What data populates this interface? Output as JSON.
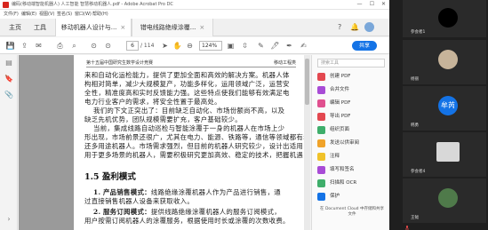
{
  "titlebar": {
    "title": "编码(移动端智能机器人) 人工智能 智慧移动机器人.pdf - Adobe Acrobat Pro DC",
    "minimize": "—",
    "maximize": "☐",
    "close": "✕"
  },
  "menubar": [
    "文件(F)",
    "编辑(E)",
    "视图(V)",
    "签名(S)",
    "窗口(W)",
    "帮助(H)"
  ],
  "tabs": {
    "home": "主页",
    "tools": "工具",
    "doc": "移动机器人设计与...",
    "doc2": "错电线路绝缘涂覆..."
  },
  "toolbar": {
    "page_current": "6",
    "page_total": "/ 114",
    "zoom": "124%",
    "share_label": "共享"
  },
  "document": {
    "header_left": "第十五届中国研究生数学设计竞赛",
    "header_right": "移动工程类",
    "lines": [
      "来和自动化运检能力，提供了更加全面和高效的解决方案。机器人体",
      "构相对简单，减少大规模复产，功能多样化，运用领域广泛，运营安",
      "全性，精准度高和实时反馈能力强。这些特点使我们能够有效满足电",
      "电力行业客户的需求，将安全性置于最高处。",
      "我们的下文正突出了：目前缺乏自动化、市场份额尚不高，以及",
      "缺乏先机优势，团队规模需要扩充，客户基础较少。",
      "当前，集成线路自动巡检与智能涂覆于一身的机器人在市场上少",
      "形出现，市场前景还很广，尤其在电力、能源、铁路等，通信等领域都有着",
      "还多用途机器人。市场需求强烈，但目前的机器人研究较少，设计出适用",
      "用于更多场景的机器人，需要积极研究更加高效、稳定的技术，把握机遇！"
    ],
    "heading": "1.5 盈利模式",
    "sections": [
      {
        "num": "1.",
        "title": "产品销售模式：",
        "text": "线路绝缘涂覆机器人作为产品进行销售，通"
      },
      {
        "num": "",
        "title": "",
        "text": "过直接销售机器人设备来获取收入。"
      },
      {
        "num": "2.",
        "title": "服务订阅模式：",
        "text": "提供线路绝缘涂覆机器人的服务订阅模式，"
      },
      {
        "num": "",
        "title": "",
        "text": "用户按需订阅机器人的涂覆服务，根据使用时长或涂覆的次数收费。"
      }
    ]
  },
  "tools_pane": {
    "search_placeholder": "搜索工具",
    "items": [
      {
        "label": "创建 PDF",
        "color": "#e34850"
      },
      {
        "label": "合并文件",
        "color": "#a84cd6"
      },
      {
        "label": "编辑 PDF",
        "color": "#e0508f"
      },
      {
        "label": "导出 PDF",
        "color": "#e34850"
      },
      {
        "label": "组织页面",
        "color": "#3fae6b"
      },
      {
        "label": "发送以供审阅",
        "color": "#f0a32a"
      },
      {
        "label": "注释",
        "color": "#f0c22a"
      },
      {
        "label": "填写和签名",
        "color": "#a84cd6"
      },
      {
        "label": "扫描和 OCR",
        "color": "#3fae6b"
      },
      {
        "label": "保护",
        "color": "#1473e6"
      }
    ],
    "promo": "在 Document Cloud 中存储和共享文件"
  },
  "call_panel": {
    "participants": [
      {
        "name": "参会者1",
        "avatar": "",
        "avatar_color": "#000000",
        "kind": "black"
      },
      {
        "name": "杨丽",
        "avatar": "",
        "avatar_color": "#c7b49a",
        "kind": "photo"
      },
      {
        "name": "韩勇",
        "avatar": "牟芮",
        "avatar_color": "#1473e6",
        "kind": "text"
      },
      {
        "name": "参会者4",
        "avatar": "",
        "avatar_color": "#d8d8d8",
        "kind": "light"
      },
      {
        "name": "王钺",
        "avatar": "",
        "avatar_color": "#4f7a4a",
        "kind": "photo2"
      }
    ]
  }
}
